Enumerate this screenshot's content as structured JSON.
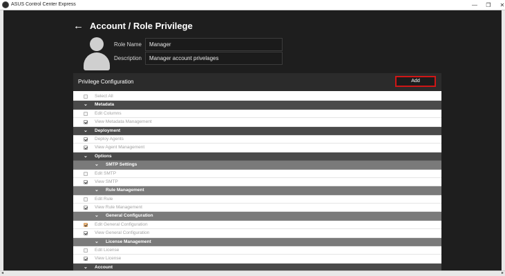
{
  "window": {
    "title": "ASUS Control Center Express",
    "minimize": "—",
    "maximize": "❐",
    "close": "✕"
  },
  "header": {
    "back": "←",
    "title": "Account / Role Privilege"
  },
  "form": {
    "role_name_label": "Role Name",
    "role_name_value": "Manager",
    "description_label": "Description",
    "description_value": "Manager account privelages"
  },
  "panel": {
    "title": "Privilege Configuration",
    "add_label": "Add"
  },
  "chevron": "⌄",
  "rows": [
    {
      "type": "item",
      "label": "Select All",
      "checked": false
    },
    {
      "type": "sec",
      "label": "Metadata"
    },
    {
      "type": "item",
      "label": "Edit Columns",
      "checked": false
    },
    {
      "type": "item",
      "label": "View Metadata Management",
      "checked": true
    },
    {
      "type": "sec",
      "label": "Deployment"
    },
    {
      "type": "item",
      "label": "Deploy Agents",
      "checked": true
    },
    {
      "type": "item",
      "label": "View Agent Management",
      "checked": true
    },
    {
      "type": "sec",
      "label": "Options"
    },
    {
      "type": "sub",
      "label": "SMTP Settings"
    },
    {
      "type": "item",
      "label": "Edit SMTP",
      "checked": false
    },
    {
      "type": "item",
      "label": "View SMTP",
      "checked": true
    },
    {
      "type": "sub",
      "label": "Rule Management"
    },
    {
      "type": "item",
      "label": "Edit Rule",
      "checked": false
    },
    {
      "type": "item",
      "label": "View Rule Management",
      "checked": true
    },
    {
      "type": "sub",
      "label": "General Configuration"
    },
    {
      "type": "item",
      "label": "Edit General Configuration",
      "checked": true,
      "highlight": true
    },
    {
      "type": "item",
      "label": "View General Configuration",
      "checked": true
    },
    {
      "type": "sub",
      "label": "License Management"
    },
    {
      "type": "item",
      "label": "Edit License",
      "checked": false
    },
    {
      "type": "item",
      "label": "View License",
      "checked": true
    },
    {
      "type": "sec",
      "label": "Account"
    }
  ],
  "scroll": {
    "left": "◂",
    "right": "▸"
  },
  "colors": {
    "add_border": "#d01616",
    "highlight_checkbox": "#f2c089"
  }
}
